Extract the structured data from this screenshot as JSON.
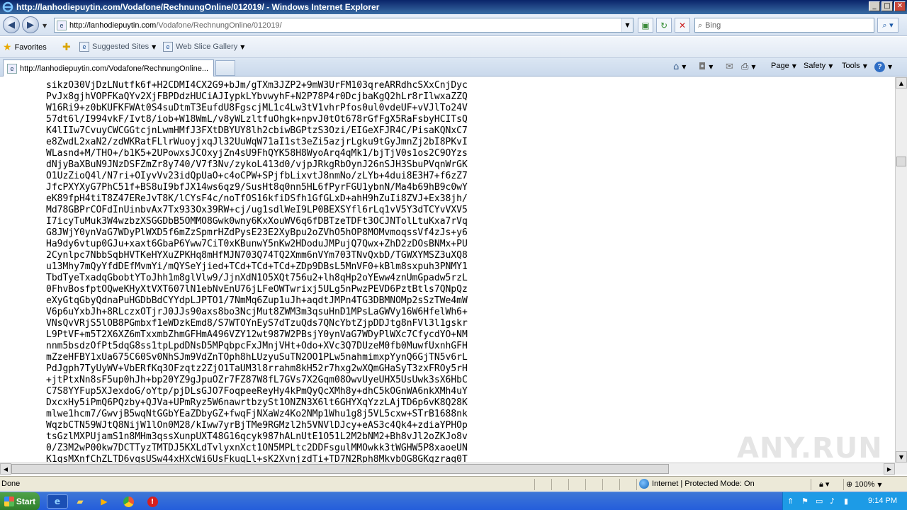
{
  "window": {
    "title": "http://lanhodiepuytin.com/Vodafone/RechnungOnline/012019/ - Windows Internet Explorer",
    "buttons": {
      "minimize": "_",
      "maximize": "□",
      "close": "✕"
    }
  },
  "address_bar": {
    "url_host": "http://lanhodiepuytin.com",
    "url_path": "/Vodafone/RechnungOnline/012019/",
    "search_placeholder": "Bing"
  },
  "favorites_bar": {
    "favorites_label": "Favorites",
    "items": [
      {
        "label": "Suggested Sites"
      },
      {
        "label": "Web Slice Gallery"
      }
    ]
  },
  "tabs": [
    {
      "label": "http://lanhodiepuytin.com/Vodafone/RechnungOnline...",
      "active": true
    }
  ],
  "command_bar": {
    "page_label": "Page",
    "safety_label": "Safety",
    "tools_label": "Tools"
  },
  "content": {
    "lines": [
      "sikzO30VjDzLNutfk6f+H2CDMI4CX2G9+bJm/gTXm3JZP2+9mW3UrFM103qreARRdhcSXxCnjDyc",
      "PvJx8gjhVOPFKaQYv2XjFBPDdzHUCiAJIypkLYbvwyhF+N2P78P4r0DcjbaKgQ2hLr8rIlwxaZZQ",
      "W16Ri9+z0bKUFKFWAt0S4suDtmT3EufdU8FgscjML1c4Lw3tV1vhrPfos0ul0vdeUF+vVJlTo24V",
      "57dt6l/I994vkF/Ivt8/iob+W18WmL/v8yWLzltfuOhgk+npvJ0tOt678rGfFgX5RaFsbyHCITsQ",
      "K4lIIw7CvuyCWCGGtcjnLwmHMfJ3FXtDBYUY8lh2cbiwBGPtzS3Ozi/EIGeXFJR4C/PisaKQNxC7",
      "e8ZwdL2xaN2/zdWKRatFLlrWuoyjxqJl32UuWqW71aI1st3eZi5azjrLgku9tGyJmnZj2bI8PKvI",
      "WLasnd+M/THO+/b1K5+2UPowxsJCOxyjZn4sU9FhQYK58H8WyoArq4qMk1/bjTjV0s1os2C9OYzs",
      "dNjyBaXBuN9JNzDSFZmZr8y740/V7f3Nv/zykoL413d0/vjpJRkgRbOynJ26nSJH3SbuPVqnWrGK",
      "O1UzZioQ4l/N7ri+OIyvVv23idQpUaO+c4oCPW+SPjfbLixvtJ8nmNo/zLYb+4dui8E3H7+f6zZ7",
      "JfcPXYXyG7PhC51f+BS8uI9bfJX14ws6qz9/SusHt8q0nn5HL6fPyrFGU1ybnN/Ma4b69hB9c0wY",
      "eK89fpH4tiT8Z47EReJvT8K/lCYsF4c/noTfOS16kfiDSfh1GfGLxD+ahH9hZuIi8ZVJ+Ex38jh/",
      "Md78GBPrCOFdInUinbvAx7Tx933Ox39RW+cj/ug1sdlWeI9LP0BEXSYfl6rLq1vV5Y3dTCYvVXV5",
      "I7icyTuMuk3W4wzbzXSGGDbB5OMMO8Gwk0wny6KxXouWV6q6fDBTzeTDFt3OCJNTolLtuKxa7rVq",
      "G8JWjY0ynVaG7WDyPlWXD5f6mZzSpmrHZdPysE23E2XyBpu2oZVhO5hOP8MOMvmoqssVf4zJs+y6",
      "Ha9dy6vtup0GJu+xaxt6GbaP6Yww7CiT0xKBunwY5nKw2HDoduJMPujQ7Qwx+ZhD2zDOsBNMx+PU",
      "2Cynlpc7NbbSqbHVTKeHYXuZPKHq8mHfMJN703Q74TQ2Xmm6nVYm703TNvQxbD/TGWXYMSZ3uXQ8",
      "u13Mhy7mQyYfdDEfMvmYi/mQYSeYjied+TCd+TCd+TCd+ZDp9DBsL5MnVF0+kBlm8sxpuh3PNMY1",
      "TbdTyeTxadqGbobtYToJhh1m8glVlw9/JjnXdN1O5XQt756u2+lh8qHp2oYEww4znUmGpadw5rzL",
      "0FhvBosfptOQweKHyXtVXT607lN1ebNvEnU76jLFeOWTwrixj5ULg5nPwzPEVD6PztBtls7QNpQz",
      "eXyGtqGbyQdnaPuHGDbBdCYYdpLJPTO1/7NmMq6Zup1uJh+aqdtJMPn4TG3DBMNOMp2sSzTWe4mW",
      "V6p6uYxbJh+8RLczxOTjrJ0JJs90axs8bo3NcjMut8ZWM3m3qsuHnD1MPsLaGWVy16W6HfelWh6+",
      "VNsQvVRjS5lOB8PGmbxf1eWDzkEmd8/S7WTOYnEyS7dTzuQds7QNcYbtZjpDDJtg8nFVl3l1gskr",
      "L9PtVF+m5T2X6XZ6mTxxmbZhmGFHmA496VZY12wt987W2PBsjY0ynVaG7WDyPlWXc7CfycdYO+NM",
      "nnm5bsdzOfPt5dqG8ss1tpLpdDNsD5MPqbpcFxJMnjVHt+Odo+XVc3Q7DUzeM0fb0MuwfUxnhGFH",
      "mZzeHFBY1xUa675C60Sv0NhSJm9VdZnTOph8hLUzyuSuTN2OO1PLw5nahmimxpYynQ6GjTN5v6rL",
      "PdJgph7TyUyWV+VbERfKq3OFzqtz2ZjO1TaUM3l8rrahm8kH52r7hxg2wXQmGHaSyT3zxFROy5rH",
      "+jtPtxNn8sF5up0hJh+bp20YZ9gJpuOZr7FZ87W8fL7GVs7X2Gqm08OwvUyeUHX5UsUwk3sX6HbC",
      "C7S8YYFup5XJexdoG/oYtp/pjDLsGJO7FoqpeeReyHy4kPmQyQcXMh8y+dhC5kOGnWA6nkXMh4uY",
      "DxcxHy5iPmQ6PQzby+QJVa+UPmRyz5W6nawrtbzySt1ONZN3X6lt6GHYXqYzzLAjTD6p6vK8Q28K",
      "mlwe1hcm7/GwvjB5wqNtGGbYEaZDbyGZ+fwqFjNXaWz4Ko2NMp1Whu1g8j5VL5cxw+STrB1688nk",
      "WqzbCTN59WJtQ8NijW1lOn0M28/kIww7yrBjTMe9RGMzl2h5VNVlDJcy+eAS3c4Qk4+zdiaYPHOp",
      "tsGzlMXPUjamS1n8MHm3qssXunpUXT48G16qcyk987hALnUtE1O51L2M2bNM2+Bh8vJl2oZKJo8v",
      "0/Z3M2wP00kw7DCTTyzTMTDJ5KXLdTvlyxnXct1ON5MPLtc2DDFsgulMMOwkk3tWGHW5P8xaoeUN",
      "K1qsMXnfChZLTD6vqsUSw44xHXcWi6UsFkugLl+sK2XvnjzdTi+TD7N2Rph8MkvbOG8GKgzrag0T"
    ]
  },
  "status_bar": {
    "status_text": "Done",
    "zone_text": "Internet | Protected Mode: On",
    "zoom_text": "100%"
  },
  "taskbar": {
    "start_label": "Start",
    "clock": "9:14 PM"
  },
  "watermark": "ANY.RUN"
}
